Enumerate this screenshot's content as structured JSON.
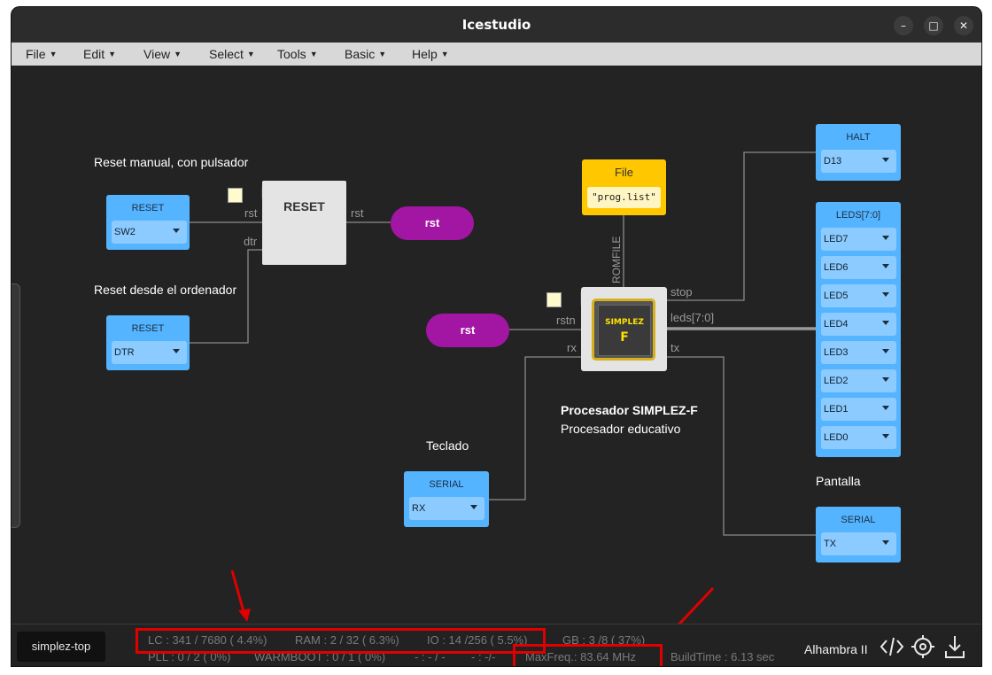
{
  "window": {
    "title": "Icestudio"
  },
  "menu": [
    {
      "label": "File"
    },
    {
      "label": "Edit"
    },
    {
      "label": "View"
    },
    {
      "label": "Select"
    },
    {
      "label": "Tools"
    },
    {
      "label": "Basic"
    },
    {
      "label": "Help"
    }
  ],
  "comments": {
    "reset_manual": "Reset manual, con pulsador",
    "reset_pc": "Reset desde el ordenador",
    "teclado": "Teclado",
    "pantalla": "Pantalla",
    "proc_title": "Procesador SIMPLEZ-F",
    "proc_sub": "Procesador educativo"
  },
  "inputs": {
    "reset1": {
      "header": "RESET",
      "value": "SW2"
    },
    "reset2": {
      "header": "RESET",
      "value": "DTR"
    },
    "serial_rx": {
      "header": "SERIAL",
      "value": "RX"
    }
  },
  "outputs": {
    "halt": {
      "header": "HALT",
      "value": "D13"
    },
    "serial_tx": {
      "header": "SERIAL",
      "value": "TX"
    },
    "leds": {
      "header": "LEDS[7:0]",
      "values": [
        "LED7",
        "LED6",
        "LED5",
        "LED4",
        "LED3",
        "LED2",
        "LED1",
        "LED0"
      ]
    }
  },
  "reset_block": {
    "title": "RESET",
    "port_rst": "rst",
    "port_dtr": "dtr",
    "out_rst": "rst"
  },
  "labels": {
    "rst_out": "rst",
    "rst_in": "rst"
  },
  "file_block": {
    "title": "File",
    "value": "\"prog.list\"",
    "port": "ROMFILE"
  },
  "cpu": {
    "chip_name": "SIMPLEZ",
    "chip_letter": "F",
    "rstn": "rstn",
    "rx": "rx",
    "stop": "stop",
    "leds": "leds[7:0]",
    "tx": "tx"
  },
  "status": {
    "tab": "simplez-top",
    "lc": "LC : 341 / 7680 ( 4.4%)",
    "ram": "RAM : 2 / 32 ( 6.3%)",
    "io": "IO :  14 /256  ( 5.5%)",
    "gb": "GB :  3 /8  ( 37%)",
    "pll": "PLL : 0 / 2 ( 0%)",
    "warmboot": "WARMBOOT : 0 / 1 ( 0%)",
    "dash1": "- : - / -",
    "dash2": "- :  -/-",
    "maxfreq": "MaxFreq.:   83.64 MHz",
    "buildtime": "BuildTime :    6.13 sec",
    "board": "Alhambra II"
  },
  "colors": {
    "io_block": "#55b4ff",
    "label_pill": "#a316a3",
    "file_block": "#ffc700",
    "highlight": "#e00000"
  }
}
